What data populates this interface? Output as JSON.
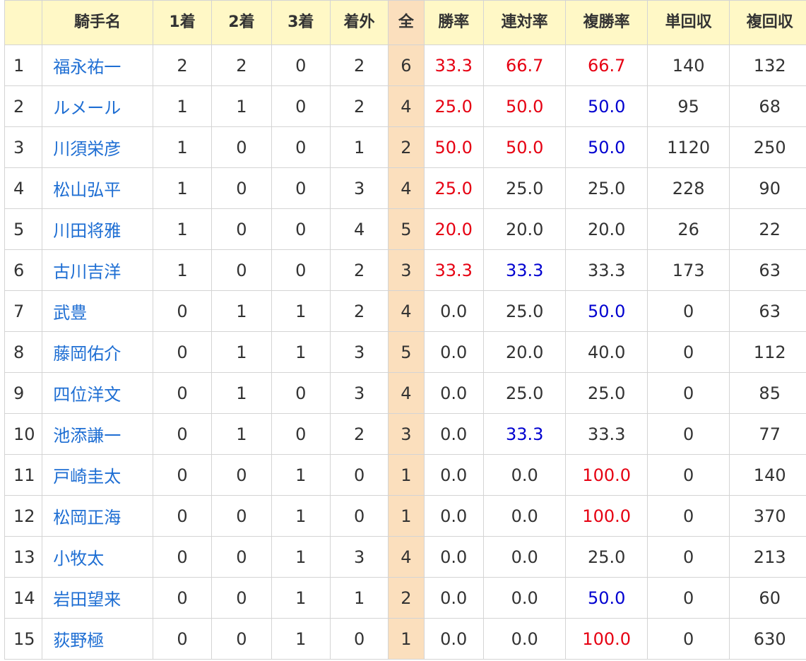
{
  "headers": {
    "rank": "",
    "name": "騎手名",
    "first": "1着",
    "second": "2着",
    "third": "3着",
    "other": "着外",
    "total": "全",
    "win_rate": "勝率",
    "quinella_rate": "連対率",
    "place_rate": "複勝率",
    "win_return": "単回収",
    "place_return": "複回収"
  },
  "colors": {
    "red": "#e60012",
    "blue": "#0000d0",
    "link": "#1e6ed3",
    "header_bg": "#fff8c6",
    "total_bg": "#fbdfbd"
  },
  "rows": [
    {
      "rank": "1",
      "name": "福永祐一",
      "first": "2",
      "second": "2",
      "third": "0",
      "other": "2",
      "total": "6",
      "win_rate": "33.3",
      "win_rate_color": "red",
      "quinella_rate": "66.7",
      "quinella_rate_color": "red",
      "place_rate": "66.7",
      "place_rate_color": "red",
      "win_return": "140",
      "place_return": "132"
    },
    {
      "rank": "2",
      "name": "ルメール",
      "first": "1",
      "second": "1",
      "third": "0",
      "other": "2",
      "total": "4",
      "win_rate": "25.0",
      "win_rate_color": "red",
      "quinella_rate": "50.0",
      "quinella_rate_color": "red",
      "place_rate": "50.0",
      "place_rate_color": "blue",
      "win_return": "95",
      "place_return": "68"
    },
    {
      "rank": "3",
      "name": "川須栄彦",
      "first": "1",
      "second": "0",
      "third": "0",
      "other": "1",
      "total": "2",
      "win_rate": "50.0",
      "win_rate_color": "red",
      "quinella_rate": "50.0",
      "quinella_rate_color": "red",
      "place_rate": "50.0",
      "place_rate_color": "blue",
      "win_return": "1120",
      "place_return": "250"
    },
    {
      "rank": "4",
      "name": "松山弘平",
      "first": "1",
      "second": "0",
      "third": "0",
      "other": "3",
      "total": "4",
      "win_rate": "25.0",
      "win_rate_color": "red",
      "quinella_rate": "25.0",
      "quinella_rate_color": "",
      "place_rate": "25.0",
      "place_rate_color": "",
      "win_return": "228",
      "place_return": "90"
    },
    {
      "rank": "5",
      "name": "川田将雅",
      "first": "1",
      "second": "0",
      "third": "0",
      "other": "4",
      "total": "5",
      "win_rate": "20.0",
      "win_rate_color": "red",
      "quinella_rate": "20.0",
      "quinella_rate_color": "",
      "place_rate": "20.0",
      "place_rate_color": "",
      "win_return": "26",
      "place_return": "22"
    },
    {
      "rank": "6",
      "name": "古川吉洋",
      "first": "1",
      "second": "0",
      "third": "0",
      "other": "2",
      "total": "3",
      "win_rate": "33.3",
      "win_rate_color": "red",
      "quinella_rate": "33.3",
      "quinella_rate_color": "blue",
      "place_rate": "33.3",
      "place_rate_color": "",
      "win_return": "173",
      "place_return": "63"
    },
    {
      "rank": "7",
      "name": "武豊",
      "first": "0",
      "second": "1",
      "third": "1",
      "other": "2",
      "total": "4",
      "win_rate": "0.0",
      "win_rate_color": "",
      "quinella_rate": "25.0",
      "quinella_rate_color": "",
      "place_rate": "50.0",
      "place_rate_color": "blue",
      "win_return": "0",
      "place_return": "63"
    },
    {
      "rank": "8",
      "name": "藤岡佑介",
      "first": "0",
      "second": "1",
      "third": "1",
      "other": "3",
      "total": "5",
      "win_rate": "0.0",
      "win_rate_color": "",
      "quinella_rate": "20.0",
      "quinella_rate_color": "",
      "place_rate": "40.0",
      "place_rate_color": "",
      "win_return": "0",
      "place_return": "112"
    },
    {
      "rank": "9",
      "name": "四位洋文",
      "first": "0",
      "second": "1",
      "third": "0",
      "other": "3",
      "total": "4",
      "win_rate": "0.0",
      "win_rate_color": "",
      "quinella_rate": "25.0",
      "quinella_rate_color": "",
      "place_rate": "25.0",
      "place_rate_color": "",
      "win_return": "0",
      "place_return": "85"
    },
    {
      "rank": "10",
      "name": "池添謙一",
      "first": "0",
      "second": "1",
      "third": "0",
      "other": "2",
      "total": "3",
      "win_rate": "0.0",
      "win_rate_color": "",
      "quinella_rate": "33.3",
      "quinella_rate_color": "blue",
      "place_rate": "33.3",
      "place_rate_color": "",
      "win_return": "0",
      "place_return": "77"
    },
    {
      "rank": "11",
      "name": "戸崎圭太",
      "first": "0",
      "second": "0",
      "third": "1",
      "other": "0",
      "total": "1",
      "win_rate": "0.0",
      "win_rate_color": "",
      "quinella_rate": "0.0",
      "quinella_rate_color": "",
      "place_rate": "100.0",
      "place_rate_color": "red",
      "win_return": "0",
      "place_return": "140"
    },
    {
      "rank": "12",
      "name": "松岡正海",
      "first": "0",
      "second": "0",
      "third": "1",
      "other": "0",
      "total": "1",
      "win_rate": "0.0",
      "win_rate_color": "",
      "quinella_rate": "0.0",
      "quinella_rate_color": "",
      "place_rate": "100.0",
      "place_rate_color": "red",
      "win_return": "0",
      "place_return": "370"
    },
    {
      "rank": "13",
      "name": "小牧太",
      "first": "0",
      "second": "0",
      "third": "1",
      "other": "3",
      "total": "4",
      "win_rate": "0.0",
      "win_rate_color": "",
      "quinella_rate": "0.0",
      "quinella_rate_color": "",
      "place_rate": "25.0",
      "place_rate_color": "",
      "win_return": "0",
      "place_return": "213"
    },
    {
      "rank": "14",
      "name": "岩田望来",
      "first": "0",
      "second": "0",
      "third": "1",
      "other": "1",
      "total": "2",
      "win_rate": "0.0",
      "win_rate_color": "",
      "quinella_rate": "0.0",
      "quinella_rate_color": "",
      "place_rate": "50.0",
      "place_rate_color": "blue",
      "win_return": "0",
      "place_return": "60"
    },
    {
      "rank": "15",
      "name": "荻野極",
      "first": "0",
      "second": "0",
      "third": "1",
      "other": "0",
      "total": "1",
      "win_rate": "0.0",
      "win_rate_color": "",
      "quinella_rate": "0.0",
      "quinella_rate_color": "",
      "place_rate": "100.0",
      "place_rate_color": "red",
      "win_return": "0",
      "place_return": "630"
    }
  ]
}
